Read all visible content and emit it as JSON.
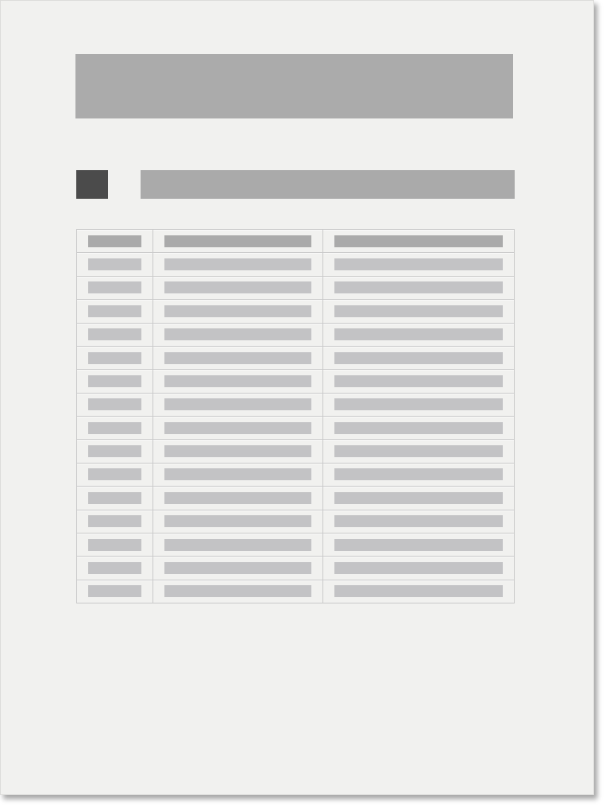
{
  "colors": {
    "page_background": "#f1f1ef",
    "title_block": "#ababab",
    "section_marker": "#4b4b4b",
    "section_heading_bar": "#aaaaaa",
    "table_grid": "#c9c9c9",
    "table_header_placeholder": "#aaaaaa",
    "table_cell_placeholder": "#c3c3c5"
  }
}
